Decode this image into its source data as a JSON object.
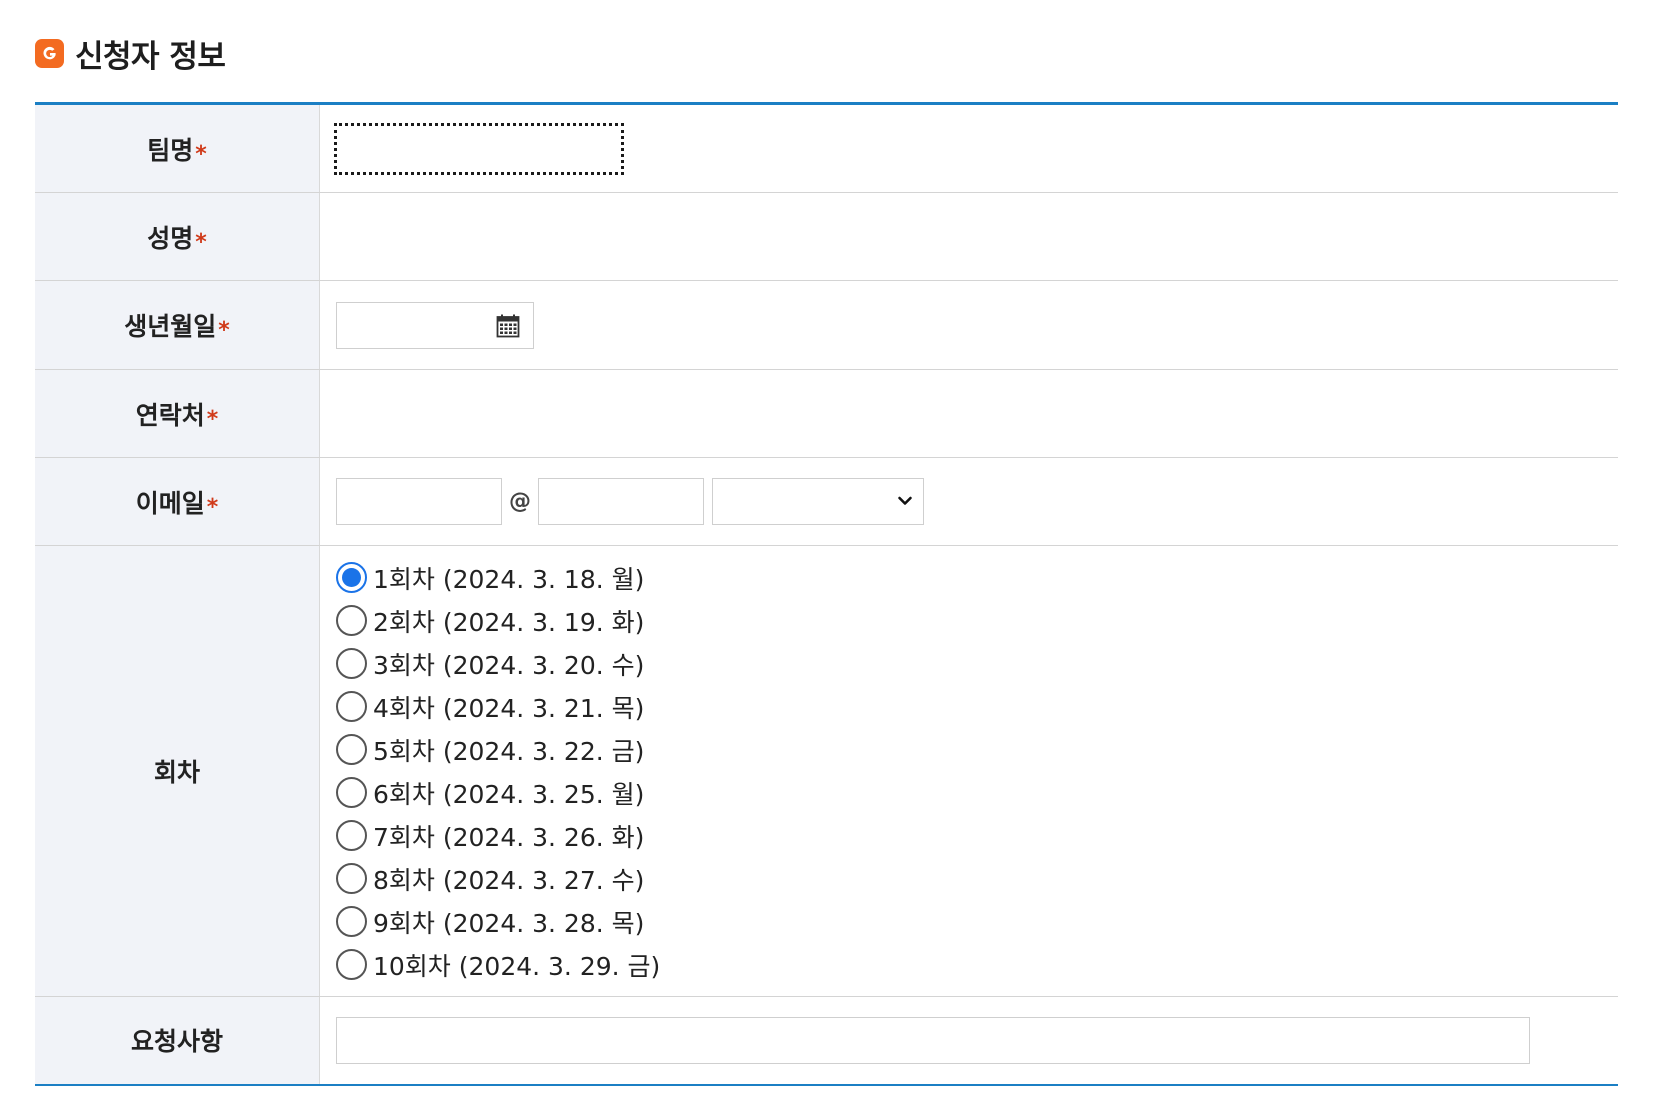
{
  "section": {
    "title": "신청자 정보",
    "icon": "g-badge-icon",
    "icon_color": "#f36b21",
    "accent_color": "#1b7fc4"
  },
  "fields": {
    "team_name": {
      "label": "팀명",
      "required_mark": "*",
      "value": ""
    },
    "name": {
      "label": "성명",
      "required_mark": "*"
    },
    "birthdate": {
      "label": "생년월일",
      "required_mark": "*",
      "value": "",
      "icon": "calendar-icon"
    },
    "contact": {
      "label": "연락처",
      "required_mark": "*"
    },
    "email": {
      "label": "이메일",
      "required_mark": "*",
      "local_value": "",
      "at": "@",
      "domain_value": "",
      "selected_domain": ""
    },
    "round": {
      "label": "회차",
      "selected_index": 0,
      "options": [
        "1회차 (2024. 3. 18. 월)",
        "2회차 (2024. 3. 19. 화)",
        "3회차 (2024. 3. 20. 수)",
        "4회차 (2024. 3. 21. 목)",
        "5회차 (2024. 3. 22. 금)",
        "6회차 (2024. 3. 25. 월)",
        "7회차 (2024. 3. 26. 화)",
        "8회차 (2024. 3. 27. 수)",
        "9회차 (2024. 3. 28. 목)",
        "10회차 (2024. 3. 29. 금)"
      ]
    },
    "request": {
      "label": "요청사항",
      "value": ""
    }
  }
}
